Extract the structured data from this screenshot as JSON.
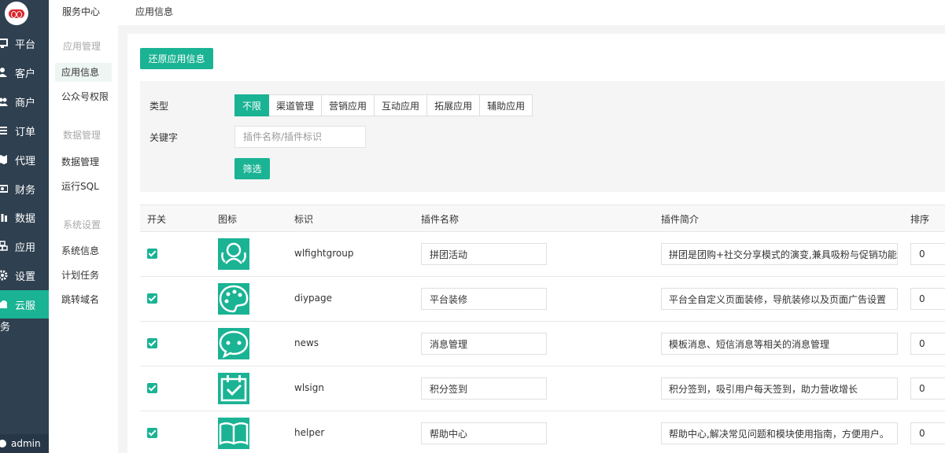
{
  "left_nav": {
    "items": [
      {
        "label": "平台",
        "icon": "monitor-icon"
      },
      {
        "label": "客户",
        "icon": "user-icon"
      },
      {
        "label": "商户",
        "icon": "users-icon"
      },
      {
        "label": "订单",
        "icon": "list-icon"
      },
      {
        "label": "代理",
        "icon": "map-icon"
      },
      {
        "label": "财务",
        "icon": "money-icon"
      },
      {
        "label": "数据",
        "icon": "bar-chart-icon"
      },
      {
        "label": "应用",
        "icon": "cubes-icon"
      },
      {
        "label": "设置",
        "icon": "gear-icon"
      },
      {
        "label": "云服",
        "icon": "cloud-icon"
      }
    ],
    "tail": "务",
    "admin": "admin",
    "accent_color": "#1ab394"
  },
  "top_bar": {
    "service_center": "服务中心",
    "app_info": "应用信息"
  },
  "sub_nav": {
    "groups": [
      {
        "title": "应用管理",
        "items": [
          "应用信息",
          "公众号权限"
        ]
      },
      {
        "title": "数据管理",
        "items": [
          "数据管理",
          "运行SQL"
        ]
      },
      {
        "title": "系统设置",
        "items": [
          "系统信息",
          "计划任务",
          "跳转域名"
        ]
      }
    ]
  },
  "main": {
    "restore_button": "还原应用信息",
    "filter": {
      "type_label": "类型",
      "types": [
        "不限",
        "渠道管理",
        "营销应用",
        "互动应用",
        "拓展应用",
        "辅助应用"
      ],
      "keyword_label": "关键字",
      "keyword_placeholder": "插件名称/插件标识",
      "filter_button": "筛选"
    },
    "table": {
      "headers": [
        "开关",
        "图标",
        "标识",
        "插件名称",
        "插件简介",
        "排序"
      ],
      "rows": [
        {
          "enabled": true,
          "icon": "group-person-icon",
          "ident": "wlfightgroup",
          "name": "拼团活动",
          "desc": "拼团是团购+社交分享模式的演变,兼具吸粉与促销功能",
          "sort": "0"
        },
        {
          "enabled": true,
          "icon": "palette-icon",
          "ident": "diypage",
          "name": "平台装修",
          "desc": "平台全自定义页面装修，导航装修以及页面广告设置",
          "sort": "0"
        },
        {
          "enabled": true,
          "icon": "chat-bubble-icon",
          "ident": "news",
          "name": "消息管理",
          "desc": "模板消息、短信消息等相关的消息管理",
          "sort": "0"
        },
        {
          "enabled": true,
          "icon": "calendar-check-icon",
          "ident": "wlsign",
          "name": "积分签到",
          "desc": "积分签到，吸引用户每天签到，助力营收增长",
          "sort": "0"
        },
        {
          "enabled": true,
          "icon": "open-book-icon",
          "ident": "helper",
          "name": "帮助中心",
          "desc": "帮助中心,解决常见问题和模块使用指南，方便用户。",
          "sort": "0"
        }
      ]
    }
  }
}
